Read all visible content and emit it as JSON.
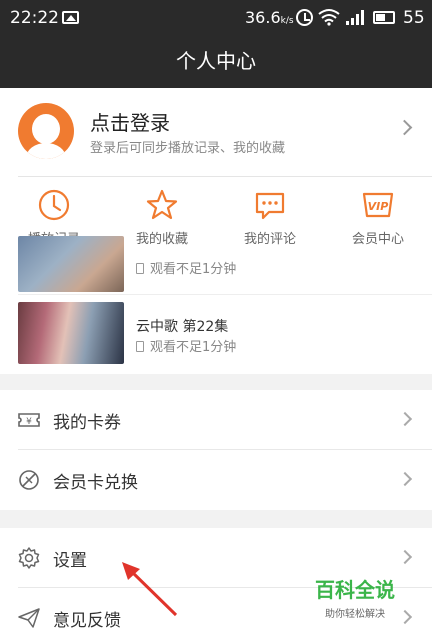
{
  "status_bar": {
    "time": "22:22",
    "speed": "36.6",
    "speed_unit": "k/s",
    "battery": "55",
    "icons": [
      "image-icon",
      "alarm-icon",
      "wifi-icon",
      "signal-icon",
      "battery-icon"
    ]
  },
  "header": {
    "title": "个人中心"
  },
  "login": {
    "title": "点击登录",
    "subtitle": "登录后可同步播放记录、我的收藏"
  },
  "quick_actions": [
    {
      "label": "播放记录",
      "icon": "clock-icon"
    },
    {
      "label": "我的收藏",
      "icon": "star-icon"
    },
    {
      "label": "我的评论",
      "icon": "comment-icon"
    },
    {
      "label": "会员中心",
      "icon": "vip-icon",
      "icon_text": "VIP"
    }
  ],
  "history": [
    {
      "title": "",
      "meta": "观看不足1分钟"
    },
    {
      "title": "云中歌 第22集",
      "meta": "观看不足1分钟"
    }
  ],
  "menu_group_1": [
    {
      "label": "我的卡券",
      "icon": "coupon-icon",
      "icon_text": "¥"
    },
    {
      "label": "会员卡兑换",
      "icon": "exchange-icon"
    }
  ],
  "menu_group_2": [
    {
      "label": "设置",
      "icon": "gear-icon"
    },
    {
      "label": "意见反馈",
      "icon": "send-icon"
    }
  ],
  "watermark": {
    "title": "百科全说",
    "subtitle": "助你轻松解决"
  },
  "colors": {
    "accent": "#f07b30",
    "header": "#2a2a2a",
    "annotation": "#e0342b",
    "watermark": "#3bb54a"
  }
}
